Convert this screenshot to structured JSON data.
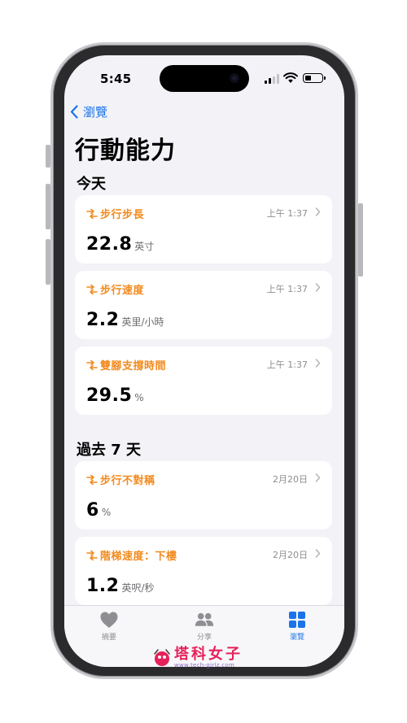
{
  "status_bar": {
    "time": "5:45"
  },
  "nav": {
    "back_label": "瀏覽"
  },
  "page": {
    "title": "行動能力"
  },
  "sections": [
    {
      "title": "今天"
    },
    {
      "title": "過去 7 天"
    }
  ],
  "cards": [
    {
      "name": "步行步長",
      "date": "上午 1:37",
      "value": "22.8",
      "unit": "英寸"
    },
    {
      "name": "步行速度",
      "date": "上午 1:37",
      "value": "2.2",
      "unit": "英里/小時"
    },
    {
      "name": "雙腳支撐時間",
      "date": "上午 1:37",
      "value": "29.5",
      "unit": "%"
    },
    {
      "name": "步行不對稱",
      "date": "2月20日",
      "value": "6",
      "unit": "%"
    },
    {
      "name": "階梯速度：下樓",
      "date": "2月20日",
      "value": "1.2",
      "unit": "英呎/秒"
    }
  ],
  "tabbar": {
    "tabs": [
      {
        "label": "摘要",
        "icon": "heart-icon"
      },
      {
        "label": "分享",
        "icon": "people-icon"
      },
      {
        "label": "瀏覽",
        "icon": "grid-icon",
        "selected": true
      }
    ]
  },
  "colors": {
    "accent": "#1a73e8",
    "mobility": "#f28a1e",
    "background": "#f2f2f7"
  },
  "watermark": {
    "main": "塔科女子",
    "sub": "www.tech-girlz.com"
  }
}
